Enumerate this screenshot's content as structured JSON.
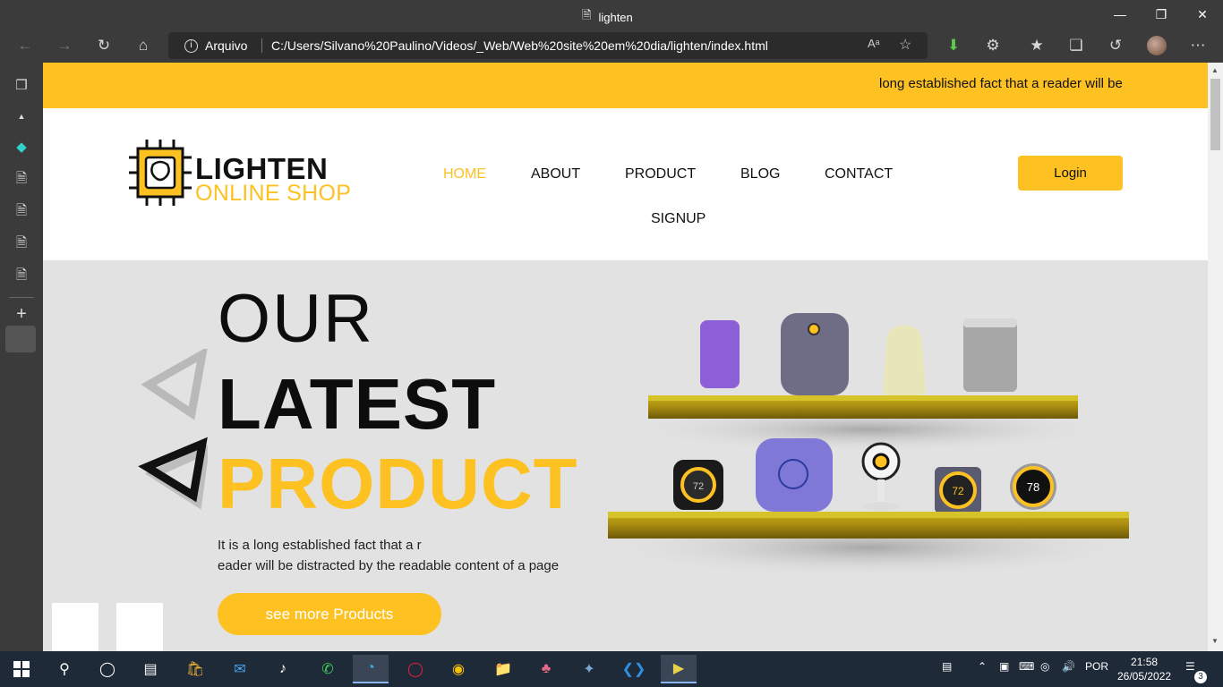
{
  "browser": {
    "tab_title": "lighten",
    "address_prefix": "Arquivo",
    "url": "C:/Users/Silvano%20Paulino/Videos/_Web/Web%20site%20em%20dia/lighten/index.html",
    "read_aloud": "Aᵃ"
  },
  "page": {
    "marquee_text": "long established fact that a reader will be",
    "logo": {
      "line1": "LIGHTEN",
      "line2": "ONLINE SHOP"
    },
    "menu": [
      {
        "label": "HOME",
        "active": true
      },
      {
        "label": "ABOUT"
      },
      {
        "label": "PRODUCT"
      },
      {
        "label": "BLOG"
      },
      {
        "label": "CONTACT"
      },
      {
        "label": "SIGNUP"
      }
    ],
    "login_label": "Login",
    "hero": {
      "line1": "OUR",
      "line2": "LATEST",
      "line3": "PRODUCT",
      "desc_line1": "It is a long established fact that a r",
      "desc_line2": "eader will be distracted by the readable content of a page",
      "cta_label": "see more Products"
    },
    "device_readouts": [
      "72",
      "72",
      "78"
    ]
  },
  "taskbar": {
    "language": "POR",
    "time": "21:58",
    "date": "26/05/2022",
    "notifications": "3"
  },
  "colors": {
    "accent": "#fdc122",
    "chrome": "#3b3b3b",
    "taskbar": "#1f2a38",
    "hero_bg": "#e2e2e2"
  }
}
